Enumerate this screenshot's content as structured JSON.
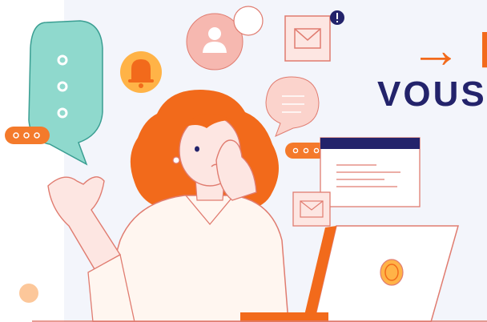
{
  "headline": {
    "arrow_line": "→ F",
    "second_line": "VOUS"
  },
  "colors": {
    "accent_orange": "#f26a1b",
    "navy": "#23236b",
    "teal_bubble": "#8fd9cd",
    "pink_bubble": "#f6b8b0",
    "light_panel": "#f3f5fb"
  },
  "icons": [
    "chat-bubble-icon",
    "bell-icon",
    "user-bubble-icon",
    "mail-icon",
    "alert-badge-icon",
    "message-bubble-icon",
    "typing-dots-icon",
    "browser-window-icon",
    "laptop-icon",
    "coin-icon"
  ]
}
